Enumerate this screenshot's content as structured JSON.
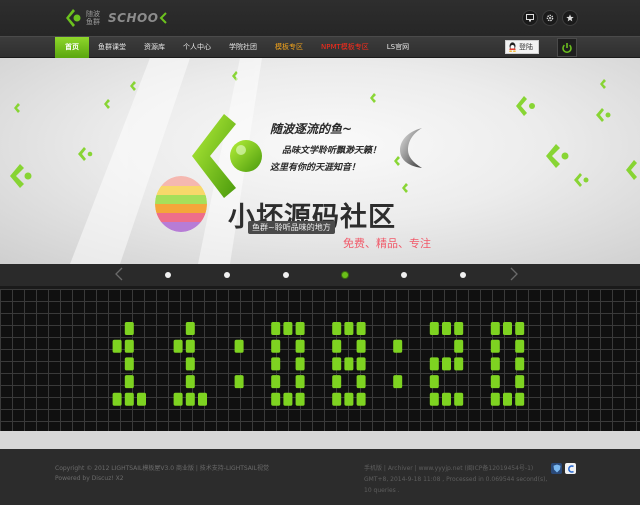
{
  "header": {
    "logo_cn": "随波 鱼群",
    "logo_en": "SCHOO",
    "icons": [
      "monitor-icon",
      "gear-icon",
      "star-icon"
    ]
  },
  "nav": {
    "items": [
      {
        "label": "首页",
        "state": "active"
      },
      {
        "label": "鱼群课堂"
      },
      {
        "label": "资源库"
      },
      {
        "label": "个人中心"
      },
      {
        "label": "学院社团"
      },
      {
        "label": "模板专区",
        "color": "#f2a31b"
      },
      {
        "label": "NPMT模板专区",
        "color": "#ff2a1a"
      },
      {
        "label": "LS官网"
      }
    ],
    "login_label": "登陆"
  },
  "banner": {
    "slogan_1": "随波逐流的鱼~",
    "slogan_2": "品味文学聆听飘渺天籁！",
    "slogan_3": "这里有你的天涯知音！",
    "watermark_title": "小坏源码社区",
    "watermark_sub": "鱼群~聆听品味的地方",
    "watermark_tag": "免费、精品、专注"
  },
  "slider": {
    "dot_count": 6,
    "active_index": 3
  },
  "clock": {
    "time": "11:08:20",
    "color": "#7ed321"
  },
  "footer": {
    "line1": "Copyright © 2012 LIGHTSAIL模板屋V3.0 商业版 | 技术支持-LIGHTSAIL视觉",
    "line2": "Powered by Discuz! X2",
    "right_line1": "手机版 | Archiver | www.yyyjp.net (闽ICP备12019454号-1)",
    "right_line2": "GMT+8, 2014-9-18 11:08 , Processed in 0.069544 second(s), 10 queries ."
  },
  "colors": {
    "accent": "#7ed321",
    "nav_active": "#6bbf1a",
    "bg_dark": "#2b2b2b"
  }
}
